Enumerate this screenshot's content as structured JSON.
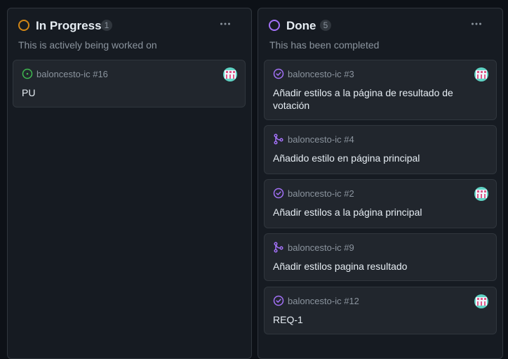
{
  "columns": {
    "in_progress": {
      "title": "In Progress",
      "count": "1",
      "description": "This is actively being worked on",
      "status_color": "#d18616",
      "cards": [
        {
          "repo": "baloncesto-ic #16",
          "title": "PU",
          "icon": "issue-open-icon",
          "has_avatar": true
        }
      ]
    },
    "done": {
      "title": "Done",
      "count": "5",
      "description": "This has been completed",
      "status_color": "#a371f7",
      "cards": [
        {
          "repo": "baloncesto-ic #3",
          "title": "Añadir estilos a la página de resultado de votación",
          "icon": "issue-closed-icon",
          "has_avatar": true
        },
        {
          "repo": "baloncesto-ic #4",
          "title": "Añadido estilo en página principal",
          "icon": "pull-request-merged-icon",
          "has_avatar": false
        },
        {
          "repo": "baloncesto-ic #2",
          "title": "Añadir estilos a la página principal",
          "icon": "issue-closed-icon",
          "has_avatar": true
        },
        {
          "repo": "baloncesto-ic #9",
          "title": "Añadir estilos pagina resultado",
          "icon": "pull-request-merged-icon",
          "has_avatar": false
        },
        {
          "repo": "baloncesto-ic #12",
          "title": "REQ-1",
          "icon": "issue-closed-icon",
          "has_avatar": true
        }
      ]
    }
  },
  "colors": {
    "open": "#3fb950",
    "done": "#a371f7",
    "background": "#0d1117",
    "column": "#161b22",
    "card": "#21262d"
  }
}
